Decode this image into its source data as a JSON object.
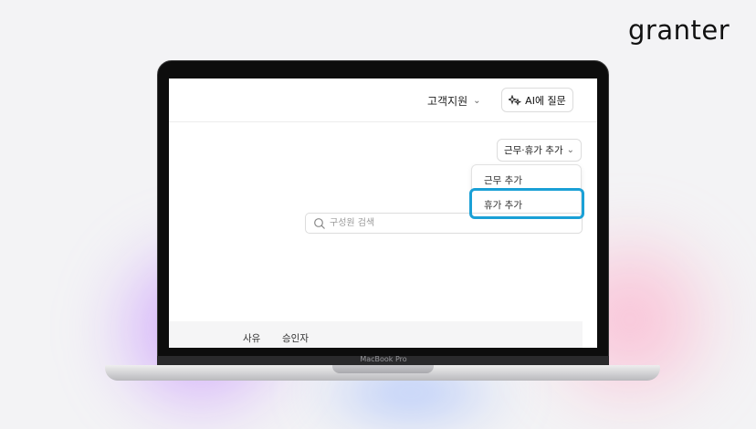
{
  "brand": {
    "name": "granter"
  },
  "header": {
    "support_label": "고객지원",
    "ai_button_label": "AI에 질문"
  },
  "toolbar": {
    "add_button_label": "근무·휴가 추가"
  },
  "dropdown": {
    "items": [
      "근무 추가",
      "휴가 추가"
    ],
    "highlighted_index": 1,
    "highlight_color": "#1aa0d6"
  },
  "search": {
    "placeholder": "구성원 검색",
    "value": ""
  },
  "table": {
    "columns": [
      "사유",
      "승인자"
    ]
  },
  "device": {
    "label": "MacBook Pro"
  }
}
